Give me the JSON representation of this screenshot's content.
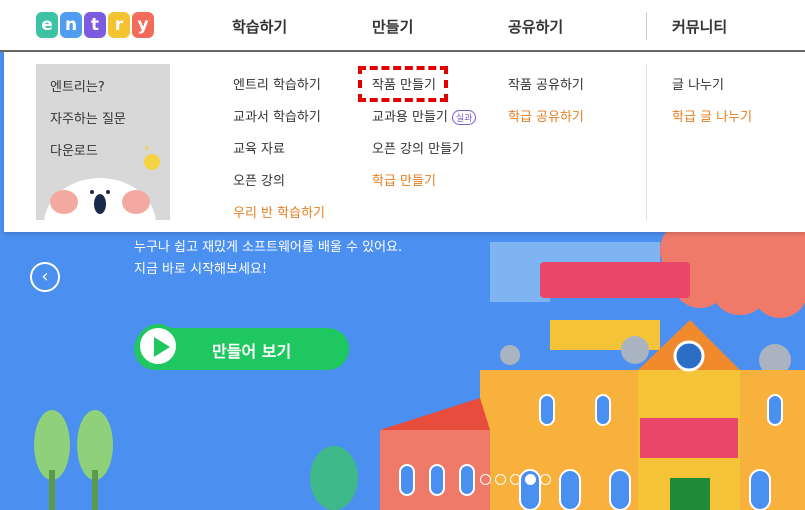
{
  "logo": {
    "letters": [
      "e",
      "n",
      "t",
      "r",
      "y"
    ]
  },
  "nav": {
    "items": [
      "학습하기",
      "만들기",
      "공유하기",
      "커뮤니티"
    ]
  },
  "help": {
    "items": [
      "엔트리는?",
      "자주하는 질문",
      "다운로드"
    ]
  },
  "menus": {
    "learn": [
      {
        "label": "엔트리 학습하기",
        "style": "normal"
      },
      {
        "label": "교과서 학습하기",
        "style": "normal"
      },
      {
        "label": "교육 자료",
        "style": "normal"
      },
      {
        "label": "오픈 강의",
        "style": "normal"
      },
      {
        "label": "우리 반 학습하기",
        "style": "orange"
      }
    ],
    "make": [
      {
        "label": "작품 만들기",
        "style": "normal"
      },
      {
        "label": "교과용 만들기",
        "style": "normal",
        "badge": "실과"
      },
      {
        "label": "오픈 강의 만들기",
        "style": "normal"
      },
      {
        "label": "학급 만들기",
        "style": "orange"
      }
    ],
    "share": [
      {
        "label": "작품 공유하기",
        "style": "normal"
      },
      {
        "label": "학급 공유하기",
        "style": "orange"
      }
    ],
    "community": [
      {
        "label": "글 나누기",
        "style": "normal"
      },
      {
        "label": "학급 글 나누기",
        "style": "orange"
      }
    ]
  },
  "hero": {
    "line1": "누구나 쉽고 재밌게 소프트웨어를 배울 수 있어요.",
    "line2": "지금 바로 시작해보세요!",
    "cta": "만들어 보기",
    "prev_icon": "‹",
    "slide_count": 5,
    "active_slide": 4
  },
  "colors": {
    "accent_orange": "#e67e22",
    "cta_green": "#1ec760",
    "highlight_red": "#e00000",
    "hero_blue": "#4b8ff0"
  }
}
